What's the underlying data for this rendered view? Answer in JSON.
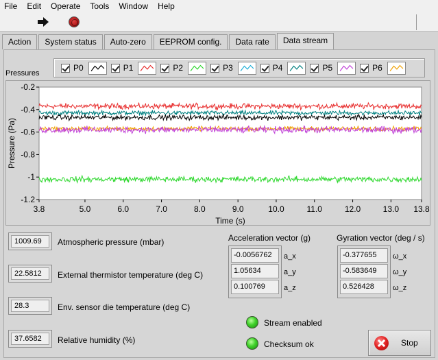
{
  "menu": [
    "File",
    "Edit",
    "Operate",
    "Tools",
    "Window",
    "Help"
  ],
  "toolbar": {
    "run_icon": "run-arrow-icon",
    "stop_icon": "abort-icon"
  },
  "tabs": [
    {
      "label": "Action",
      "active": false
    },
    {
      "label": "System status",
      "active": false
    },
    {
      "label": "Auto-zero",
      "active": false
    },
    {
      "label": "EEPROM config.",
      "active": false
    },
    {
      "label": "Data rate",
      "active": false
    },
    {
      "label": "Data stream",
      "active": true
    }
  ],
  "pressures_label": "Pressures",
  "legend": [
    {
      "name": "P0",
      "color": "#000000"
    },
    {
      "name": "P1",
      "color": "#e83030"
    },
    {
      "name": "P2",
      "color": "#30d830"
    },
    {
      "name": "P3",
      "color": "#20b0d8"
    },
    {
      "name": "P4",
      "color": "#008080"
    },
    {
      "name": "P5",
      "color": "#c040d8"
    },
    {
      "name": "P6",
      "color": "#f0a000"
    }
  ],
  "chart_data": {
    "type": "line",
    "xlabel": "Time (s)",
    "ylabel": "Pressure (Pa)",
    "xlim": [
      3.8,
      13.8
    ],
    "ylim": [
      -1.2,
      -0.2
    ],
    "x_ticks": [
      "3.8",
      "5.0",
      "6.0",
      "7.0",
      "8.0",
      "9.0",
      "10.0",
      "11.0",
      "12.0",
      "13.0",
      "13.8"
    ],
    "y_ticks": [
      "-0.2",
      "-0.4",
      "-0.6",
      "-0.8",
      "-1",
      "-1.2"
    ],
    "grid": false,
    "series": [
      {
        "name": "P1",
        "color": "#e83030",
        "mean": -0.37,
        "noise": 0.015
      },
      {
        "name": "P4",
        "color": "#008080",
        "mean": -0.43,
        "noise": 0.012
      },
      {
        "name": "P0",
        "color": "#000000",
        "mean": -0.47,
        "noise": 0.014
      },
      {
        "name": "P6",
        "color": "#f0a000",
        "mean": -0.57,
        "noise": 0.012
      },
      {
        "name": "P5",
        "color": "#c040d8",
        "mean": -0.58,
        "noise": 0.018
      },
      {
        "name": "P2",
        "color": "#30d830",
        "mean": -1.02,
        "noise": 0.016
      }
    ]
  },
  "readouts": [
    {
      "value": "1009.69",
      "label": "Atmospheric pressure (mbar)"
    },
    {
      "value": "22.5812",
      "label": "External thermistor temperature (deg C)"
    },
    {
      "value": "28.3",
      "label": "Env. sensor die temperature (deg C)"
    },
    {
      "value": "37.6582",
      "label": "Relative humidity (%)"
    }
  ],
  "acceleration": {
    "title": "Acceleration vector (g)",
    "values": [
      "-0.0056762",
      "1.05634",
      "0.100769"
    ],
    "axes": [
      "a_x",
      "a_y",
      "a_z"
    ]
  },
  "gyration": {
    "title": "Gyration vector (deg / s)",
    "values": [
      "-0.377655",
      "-0.583649",
      "0.526428"
    ],
    "axes": [
      "ω_x",
      "ω_y",
      "ω_z"
    ]
  },
  "stream_enabled_label": "Stream enabled",
  "checksum_label": "Checksum ok",
  "stop_label": "Stop"
}
